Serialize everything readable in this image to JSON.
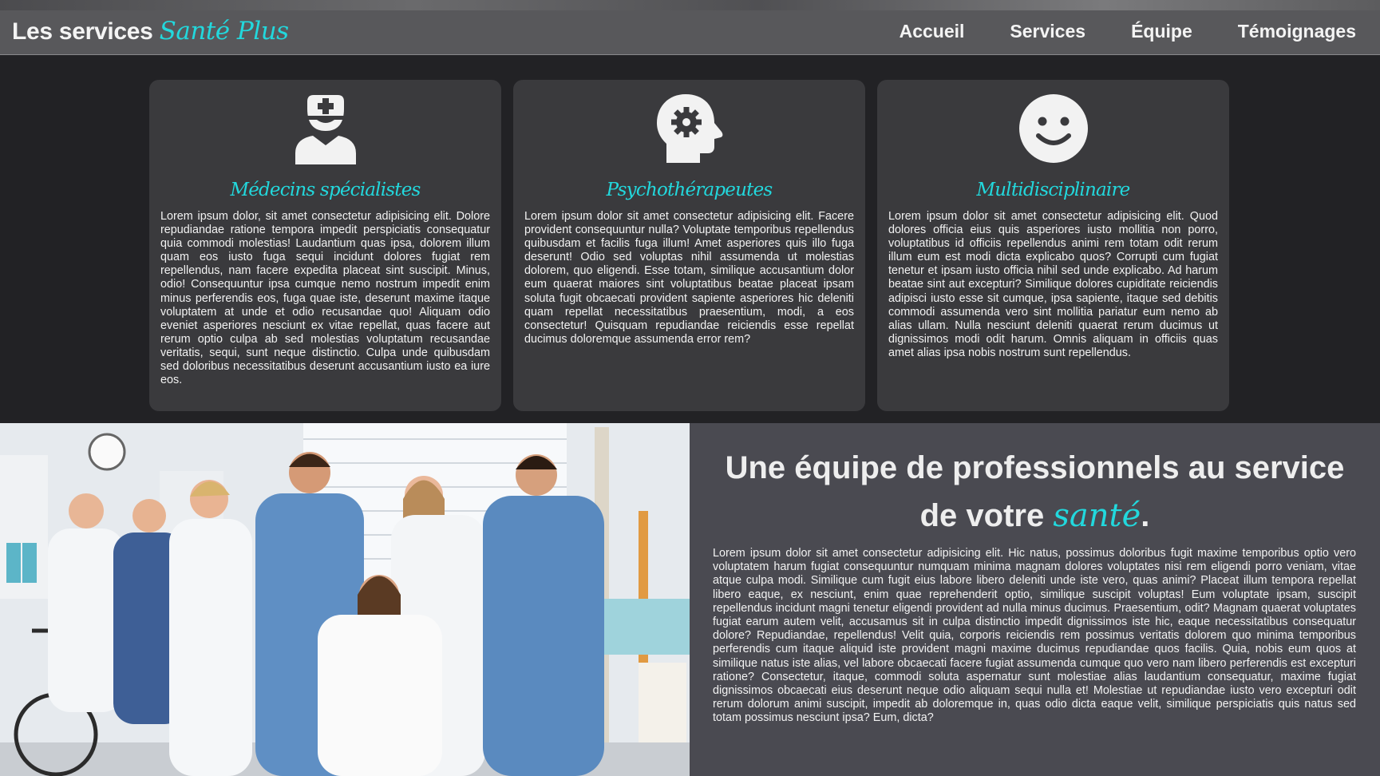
{
  "header": {
    "brand_prefix": "Les services",
    "brand_accent": "Santé Plus",
    "nav": [
      "Accueil",
      "Services",
      "Équipe",
      "Témoignages"
    ]
  },
  "colors": {
    "accent": "#22d8dd",
    "header_bg": "#58585b",
    "page_bg": "#222225",
    "card_bg": "#3a3a3d",
    "panel_bg": "#4a4a51"
  },
  "services": [
    {
      "icon": "doctor-icon",
      "title": "Médecins spécialistes",
      "text": "Lorem ipsum dolor, sit amet consectetur adipisicing elit. Dolore repudiandae ratione tempora impedit perspiciatis consequatur quia commodi molestias! Laudantium quas ipsa, dolorem illum quam eos iusto fuga sequi incidunt dolores fugiat rem repellendus, nam facere expedita placeat sint suscipit. Minus, odio! Consequuntur ipsa cumque nemo nostrum impedit enim minus perferendis eos, fuga quae iste, deserunt maxime itaque voluptatem at unde et odio recusandae quo! Aliquam odio eveniet asperiores nesciunt ex vitae repellat, quas facere aut rerum optio culpa ab sed molestias voluptatum recusandae veritatis, sequi, sunt neque distinctio. Culpa unde quibusdam sed doloribus necessitatibus deserunt accusantium iusto ea iure eos."
    },
    {
      "icon": "head-gear-icon",
      "title": "Psychothérapeutes",
      "text": "Lorem ipsum dolor sit amet consectetur adipisicing elit. Facere provident consequuntur nulla? Voluptate temporibus repellendus quibusdam et facilis fuga illum! Amet asperiores quis illo fuga deserunt! Odio sed voluptas nihil assumenda ut molestias dolorem, quo eligendi. Esse totam, similique accusantium dolor eum quaerat maiores sint voluptatibus beatae placeat ipsam soluta fugit obcaecati provident sapiente asperiores hic deleniti quam repellat necessitatibus praesentium, modi, a eos consectetur! Quisquam repudiandae reiciendis esse repellat ducimus doloremque assumenda error rem?"
    },
    {
      "icon": "smiley-icon",
      "title": "Multidisciplinaire",
      "text": "Lorem ipsum dolor sit amet consectetur adipisicing elit. Quod dolores officia eius quis asperiores iusto mollitia non porro, voluptatibus id officiis repellendus animi rem totam odit rerum illum eum est modi dicta explicabo quos? Corrupti cum fugiat tenetur et ipsam iusto officia nihil sed unde explicabo. Ad harum beatae sint aut excepturi? Similique dolores cupiditate reiciendis adipisci iusto esse sit cumque, ipsa sapiente, itaque sed debitis commodi assumenda vero sint mollitia pariatur eum nemo ab alias ullam. Nulla nesciunt deleniti quaerat rerum ducimus ut dignissimos modi odit harum. Omnis aliquam in officiis quas amet alias ipsa nobis nostrum sunt repellendus."
    }
  ],
  "team": {
    "title_prefix": "Une équipe de professionnels au service de votre",
    "title_accent": "santé",
    "title_suffix": ".",
    "text": "Lorem ipsum dolor sit amet consectetur adipisicing elit. Hic natus, possimus doloribus fugit maxime temporibus optio vero voluptatem harum fugiat consequuntur numquam minima magnam dolores voluptates nisi rem eligendi porro veniam, vitae atque culpa modi. Similique cum fugit eius labore libero deleniti unde iste vero, quas animi? Placeat illum tempora repellat libero eaque, ex nesciunt, enim quae reprehenderit optio, similique suscipit voluptas! Eum voluptate ipsam, suscipit repellendus incidunt magni tenetur eligendi provident ad nulla minus ducimus. Praesentium, odit? Magnam quaerat voluptates fugiat earum autem velit, accusamus sit in culpa distinctio impedit dignissimos iste hic, eaque necessitatibus consequatur dolore? Repudiandae, repellendus! Velit quia, corporis reiciendis rem possimus veritatis dolorem quo minima temporibus perferendis cum itaque aliquid iste provident magni maxime ducimus repudiandae quos facilis. Quia, nobis eum quos at similique natus iste alias, vel labore obcaecati facere fugiat assumenda cumque quo vero nam libero perferendis est excepturi ratione? Consectetur, itaque, commodi soluta aspernatur sunt molestiae alias laudantium consequatur, maxime fugiat dignissimos obcaecati eius deserunt neque odio aliquam sequi nulla et! Molestiae ut repudiandae iusto vero excepturi odit rerum dolorum animi suscipit, impedit ab doloremque in, quas odio dicta eaque velit, similique perspiciatis quis natus sed totam possimus nesciunt ipsa? Eum, dicta?"
  }
}
